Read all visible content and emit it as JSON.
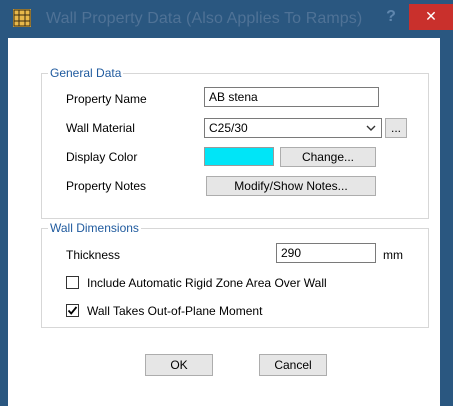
{
  "window": {
    "title": "Wall Property Data  (Also Applies To Ramps)",
    "help_glyph": "?",
    "close_glyph": "✕",
    "icon": "grid-app-icon"
  },
  "general": {
    "title": "General Data",
    "property_name_label": "Property Name",
    "property_name_value": "AB stena",
    "wall_material_label": "Wall Material",
    "wall_material_value": "C25/30",
    "material_browse_label": "...",
    "display_color_label": "Display Color",
    "display_color_value": "#00e5f7",
    "change_label": "Change...",
    "property_notes_label": "Property Notes",
    "notes_button_label": "Modify/Show Notes..."
  },
  "dimensions": {
    "title": "Wall Dimensions",
    "thickness_label": "Thickness",
    "thickness_value": "290",
    "thickness_unit": "mm",
    "rigid_zone_label": "Include Automatic Rigid Zone Area Over Wall",
    "rigid_zone_checked": false,
    "out_of_plane_label": "Wall Takes Out-of-Plane Moment",
    "out_of_plane_checked": true
  },
  "footer": {
    "ok_label": "OK",
    "cancel_label": "Cancel"
  },
  "colors": {
    "titlebar": "#2a5780",
    "close": "#c9302c",
    "group_title": "#1f5a9e"
  }
}
